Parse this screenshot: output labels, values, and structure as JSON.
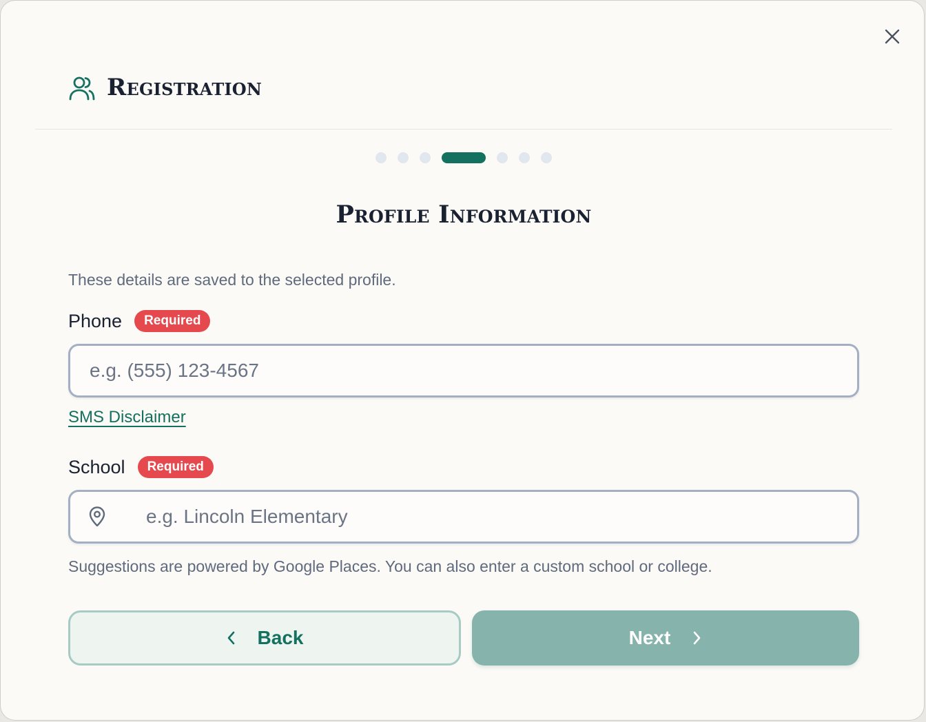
{
  "header": {
    "title": "Registration",
    "icon": "users-icon"
  },
  "stepper": {
    "total_steps": 7,
    "current_step": 4
  },
  "section": {
    "title": "Profile Information",
    "hint": "These details are saved to the selected profile."
  },
  "phone": {
    "label": "Phone",
    "badge": "Required",
    "value": "",
    "placeholder": "e.g. (555) 123-4567",
    "link_label": "SMS Disclaimer"
  },
  "school": {
    "label": "School",
    "badge": "Required",
    "value": "",
    "placeholder": "e.g. Lincoln Elementary",
    "icon": "map-pin-icon",
    "help": "Suggestions are powered by Google Places. You can also enter a custom school or college."
  },
  "actions": {
    "back_label": "Back",
    "next_label": "Next"
  },
  "colors": {
    "accent": "#14705f",
    "required_badge": "#e5484d",
    "next_button_disabled": "#86b3ac",
    "back_button_bg": "#eef4f0"
  }
}
